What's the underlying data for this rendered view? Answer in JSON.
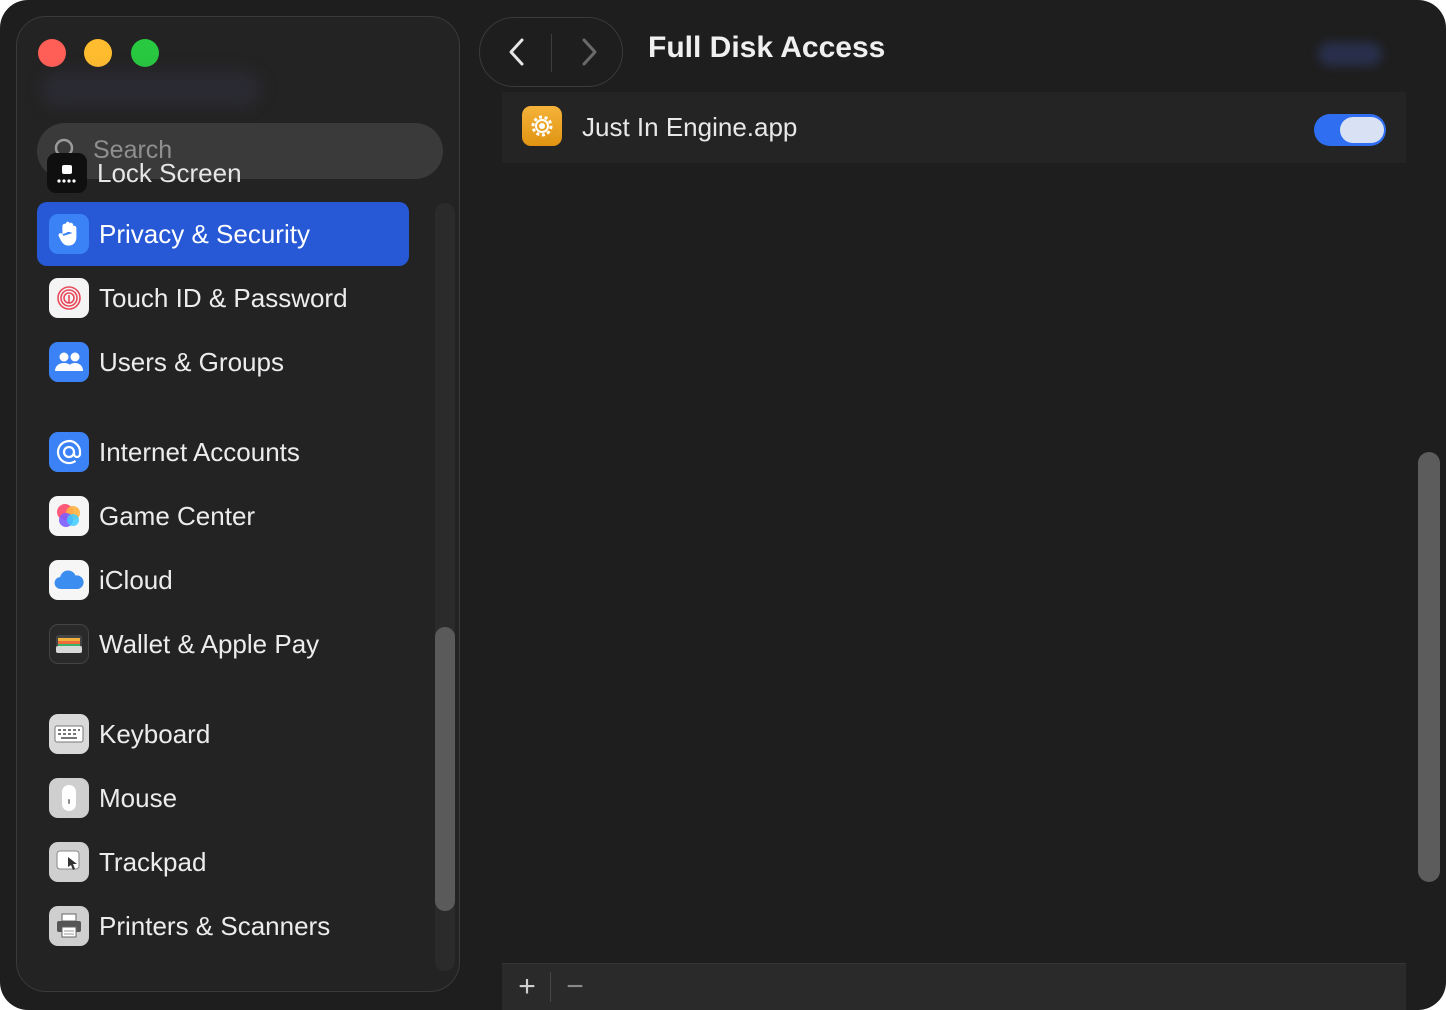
{
  "window": {
    "traffic_lights": [
      "close",
      "minimize",
      "zoom"
    ]
  },
  "sidebar": {
    "search": {
      "placeholder": "Search"
    },
    "partial_item": {
      "label": "Lock Screen",
      "icon": "lock-screen-icon"
    },
    "items": [
      {
        "label": "Privacy & Security",
        "icon": "hand-icon",
        "active": true
      },
      {
        "label": "Touch ID & Password",
        "icon": "fingerprint-icon"
      },
      {
        "label": "Users & Groups",
        "icon": "users-icon"
      },
      {
        "label": "Internet Accounts",
        "icon": "at-sign-icon"
      },
      {
        "label": "Game Center",
        "icon": "game-center-icon"
      },
      {
        "label": "iCloud",
        "icon": "icloud-icon"
      },
      {
        "label": "Wallet & Apple Pay",
        "icon": "wallet-icon"
      },
      {
        "label": "Keyboard",
        "icon": "keyboard-icon"
      },
      {
        "label": "Mouse",
        "icon": "mouse-icon"
      },
      {
        "label": "Trackpad",
        "icon": "trackpad-icon"
      },
      {
        "label": "Printers & Scanners",
        "icon": "printer-icon"
      }
    ]
  },
  "header": {
    "title": "Full Disk Access"
  },
  "content": {
    "apps": [
      {
        "name": "Just In Engine.app",
        "icon": "gear-icon",
        "enabled": true
      }
    ],
    "toolbar": {
      "add_label": "+",
      "remove_label": "−"
    }
  },
  "colors": {
    "accent": "#2759d6",
    "toggle_on": "#2f6ef0",
    "background": "#1e1e1e",
    "sidebar": "#232323"
  }
}
